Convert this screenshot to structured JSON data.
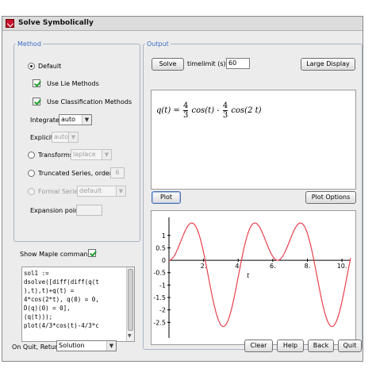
{
  "window": {
    "title": "Solve Symbolically"
  },
  "method": {
    "title": "Method",
    "default_label": "Default",
    "use_lie_label": "Use Lie Methods",
    "use_classification_label": "Use Classification Methods",
    "integrate_label": "Integrate",
    "integrate_value": "auto",
    "explicit_label": "Explicit",
    "explicit_value": "auto",
    "transforms_label": "Transforms",
    "transforms_value": "laplace",
    "truncated_label": "Truncated Series, order=",
    "truncated_order": "6",
    "formal_label": "Formal Series",
    "formal_value": "default",
    "expansion_label": "Expansion point",
    "expansion_value": ""
  },
  "maple": {
    "show_label": "Show Maple commands",
    "code": "sol1 :=\ndsolve([diff(diff(q(t\n),t),t)+q(t) =\n4*cos(2*t), q(0) = 0,\nD(q)(0) = 0],\n(q(t)));\nplot(4/3*cos(t)-4/3*c"
  },
  "output": {
    "title": "Output",
    "solve_label": "Solve",
    "timelimit_label": "timelimit (s) =",
    "timelimit_value": "60",
    "large_display_label": "Large Display",
    "math": {
      "lhs": "q(t) =",
      "num1": "4",
      "den1": "3",
      "term1": "cos(t) -",
      "num2": "4",
      "den2": "3",
      "term2": "cos(2 t)"
    },
    "plot_label": "Plot",
    "plot_options_label": "Plot Options"
  },
  "footer": {
    "on_quit_label": "On Quit, Return",
    "on_quit_value": "Solution",
    "clear_label": "Clear",
    "help_label": "Help",
    "back_label": "Back",
    "quit_label": "Quit"
  },
  "colors": {
    "curve": "#e8414d",
    "group_title": "#3b6cc4",
    "check_mark": "#1f9d2a"
  },
  "chart_data": {
    "type": "line",
    "function": "4/3*cos(t) - 4/3*cos(2*t)",
    "xlim": [
      0,
      10.5
    ],
    "ylim": [
      -3,
      1.6
    ],
    "xticks": [
      2,
      4,
      6,
      8,
      10
    ],
    "xtick_labels": [
      "2.",
      "4.",
      "6.",
      "8.",
      "10."
    ],
    "yticks": [
      1,
      0.5,
      -0.5,
      -1,
      -1.5,
      -2,
      -2.5
    ],
    "ytick_labels": [
      "1",
      "0.5",
      "-0.5",
      "-1",
      "-1.5",
      "-2",
      "-2.5"
    ],
    "xlabel": "t",
    "ylabel": "",
    "grid": false
  }
}
